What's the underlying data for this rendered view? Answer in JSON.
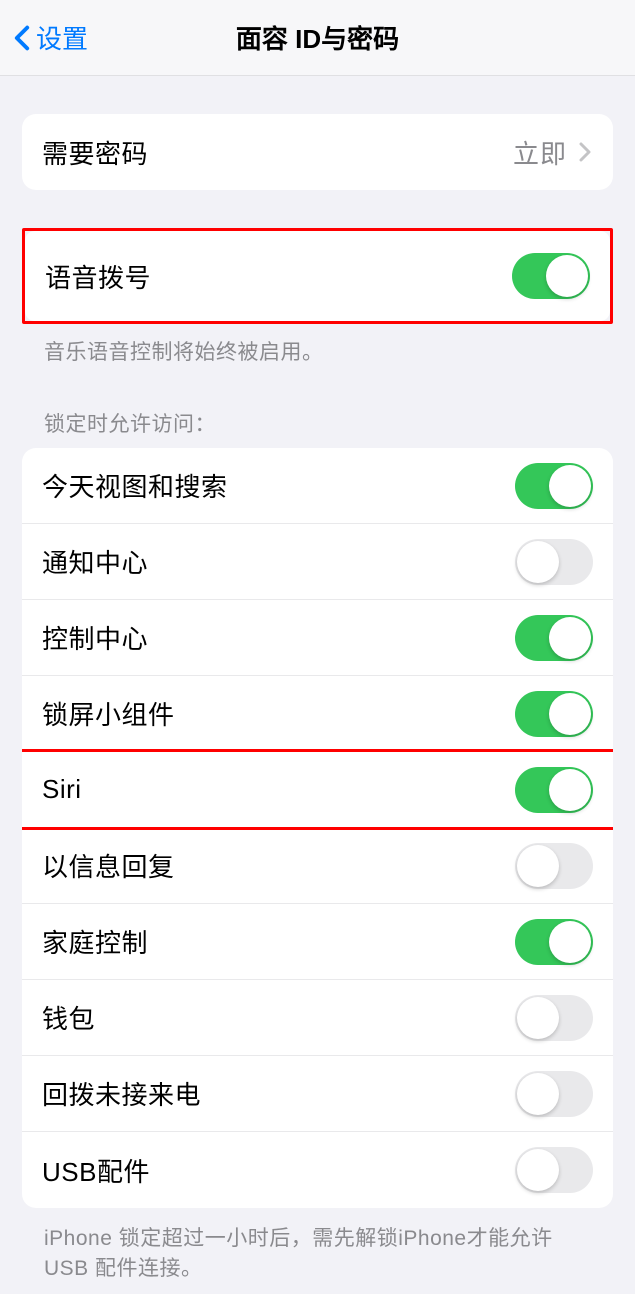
{
  "nav": {
    "back": "设置",
    "title": "面容 ID与密码"
  },
  "section1": {
    "require_passcode_label": "需要密码",
    "require_passcode_value": "立即"
  },
  "section2": {
    "voice_dial_label": "语音拨号",
    "voice_dial_on": true,
    "footer": "音乐语音控制将始终被启用。"
  },
  "section3": {
    "header": "锁定时允许访问：",
    "items": [
      {
        "label": "今天视图和搜索",
        "on": true,
        "highlighted": false
      },
      {
        "label": "通知中心",
        "on": false,
        "highlighted": false
      },
      {
        "label": "控制中心",
        "on": true,
        "highlighted": false
      },
      {
        "label": "锁屏小组件",
        "on": true,
        "highlighted": false
      },
      {
        "label": "Siri",
        "on": true,
        "highlighted": true
      },
      {
        "label": "以信息回复",
        "on": false,
        "highlighted": false
      },
      {
        "label": "家庭控制",
        "on": true,
        "highlighted": false
      },
      {
        "label": "钱包",
        "on": false,
        "highlighted": false
      },
      {
        "label": "回拨未接来电",
        "on": false,
        "highlighted": false
      },
      {
        "label": "USB配件",
        "on": false,
        "highlighted": false
      }
    ],
    "footer": "iPhone 锁定超过一小时后，需先解锁iPhone才能允许 USB 配件连接。"
  }
}
